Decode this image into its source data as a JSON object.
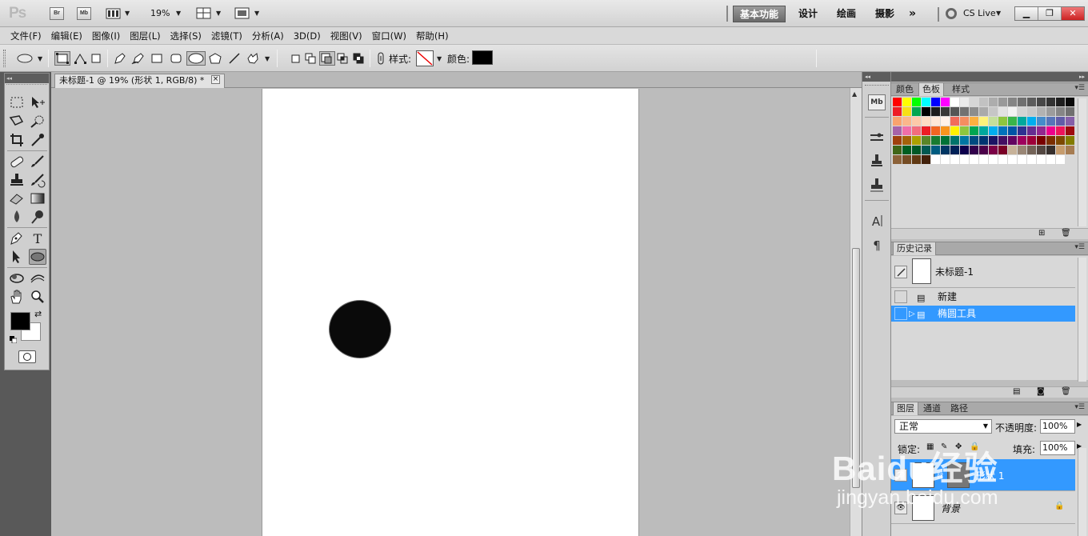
{
  "appbar": {
    "logo": "Ps",
    "br": "Br",
    "mb": "Mb",
    "zoom": "19%",
    "workspaces": [
      "基本功能",
      "设计",
      "绘画",
      "摄影"
    ],
    "more": "»",
    "cslive": "CS Live"
  },
  "menubar": [
    "文件(F)",
    "编辑(E)",
    "图像(I)",
    "图层(L)",
    "选择(S)",
    "滤镜(T)",
    "分析(A)",
    "3D(D)",
    "视图(V)",
    "窗口(W)",
    "帮助(H)"
  ],
  "options": {
    "style_label": "样式:",
    "color_label": "颜色:",
    "color_value": "#000000"
  },
  "document": {
    "tab_title": "未标题-1 @ 19% (形状 1, RGB/8) *",
    "close": "×",
    "shape_color": "#0a0a0a"
  },
  "swatches_panel": {
    "tabs": [
      "颜色",
      "色板",
      "样式"
    ],
    "active_tab": "色板",
    "colors": [
      "#ff0000",
      "#ffff00",
      "#00ff00",
      "#00ffff",
      "#0000ff",
      "#ff00ff",
      "#ffffff",
      "#ebebeb",
      "#d6d6d6",
      "#c2c2c2",
      "#adadad",
      "#999999",
      "#858585",
      "#707070",
      "#5c5c5c",
      "#474747",
      "#333333",
      "#1f1f1f",
      "#0a0a0a",
      "#ee1c24",
      "#f7e017",
      "#00a650",
      "#000000",
      "#1c1c1c",
      "#383838",
      "#555555",
      "#717171",
      "#8d8d8d",
      "#aaaaaa",
      "#c6c6c6",
      "#e2e2e2",
      "#f2f2f2",
      "#d3d3d3",
      "#c8c8c8",
      "#b2b2b2",
      "#9c9c9c",
      "#868686",
      "#707070",
      "#f9a36e",
      "#fbb78c",
      "#fdc9a9",
      "#fedbc4",
      "#fee8d8",
      "#fff2ea",
      "#f26b5b",
      "#f58d60",
      "#fbb040",
      "#fff27a",
      "#c4df9b",
      "#8dc63f",
      "#39b54a",
      "#00a99d",
      "#00aeef",
      "#448ccb",
      "#5674b9",
      "#605ca8",
      "#855fa8",
      "#a763a8",
      "#f06ea9",
      "#f26d7d",
      "#ed1c24",
      "#f26522",
      "#f7941d",
      "#fff200",
      "#8dc63f",
      "#00a651",
      "#00a99d",
      "#00aeef",
      "#0072bc",
      "#0054a6",
      "#2e3192",
      "#662d91",
      "#92278f",
      "#ec008c",
      "#ed145b",
      "#9e0b0f",
      "#a0410d",
      "#a3620a",
      "#aba000",
      "#598527",
      "#197b30",
      "#007236",
      "#00746b",
      "#0076a3",
      "#004a80",
      "#003471",
      "#1b1464",
      "#440e62",
      "#630460",
      "#9e005d",
      "#9e0039",
      "#790000",
      "#7b2e00",
      "#7d4900",
      "#827b00",
      "#406618",
      "#005e20",
      "#005826",
      "#005952",
      "#005b7f",
      "#003663",
      "#002157",
      "#0d004c",
      "#32004b",
      "#4b0049",
      "#7b0046",
      "#7a0026",
      "#c7b299",
      "#998675",
      "#736357",
      "#534741",
      "#37302d",
      "#c69c6d",
      "#a67c52",
      "#8c6239",
      "#754c24",
      "#603913",
      "#42210b",
      "#ffffff",
      "#ffffff",
      "#ffffff",
      "#ffffff",
      "#ffffff",
      "#ffffff",
      "#ffffff",
      "#ffffff",
      "#ffffff",
      "#ffffff",
      "#ffffff",
      "#ffffff",
      "#ffffff",
      "#ffffff"
    ]
  },
  "history_panel": {
    "tab": "历史记录",
    "snapshot": "未标题-1",
    "items": [
      "新建",
      "椭圆工具"
    ],
    "selected_index": 1
  },
  "layers_panel": {
    "tabs": [
      "图层",
      "通道",
      "路径"
    ],
    "blend_mode": "正常",
    "opacity_label": "不透明度:",
    "opacity": "100%",
    "lock_label": "锁定:",
    "fill_label": "填充:",
    "fill": "100%",
    "layers": [
      "形状 1",
      "背景"
    ]
  },
  "watermark": {
    "brand": "Baidu经验",
    "url": "jingyan.baidu.com"
  }
}
